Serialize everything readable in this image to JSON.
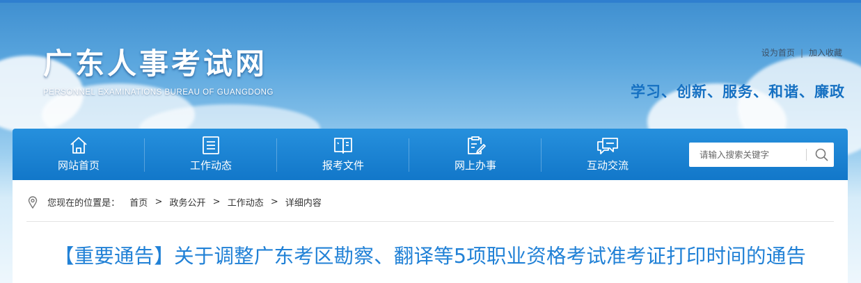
{
  "header": {
    "site_title": "广东人事考试网",
    "site_subtitle": "PERSONNEL EXAMINATIONS BUREAU OF GUANGDONG",
    "links": {
      "set_home": "设为首页",
      "separator": "|",
      "favorite": "加入收藏"
    },
    "slogan": "学习、创新、服务、和谐、廉政"
  },
  "nav": {
    "items": [
      {
        "label": "网站首页",
        "icon": "home-icon"
      },
      {
        "label": "工作动态",
        "icon": "document-list-icon"
      },
      {
        "label": "报考文件",
        "icon": "open-book-icon"
      },
      {
        "label": "网上办事",
        "icon": "clipboard-edit-icon"
      },
      {
        "label": "互动交流",
        "icon": "chat-bubbles-icon"
      }
    ],
    "search": {
      "placeholder": "请输入搜索关键字",
      "icon": "search-icon"
    }
  },
  "breadcrumb": {
    "prefix": "您现在的位置是：",
    "items": [
      "首页",
      "政务公开",
      "工作动态",
      "详细内容"
    ],
    "separator": ">"
  },
  "article": {
    "title": "【重要通告】关于调整广东考区勘察、翻译等5项职业资格考试准考证打印时间的通告"
  },
  "colors": {
    "nav_bg": "#1a82d2",
    "title_blue": "#2181d6",
    "slogan_blue": "#1570c2"
  }
}
